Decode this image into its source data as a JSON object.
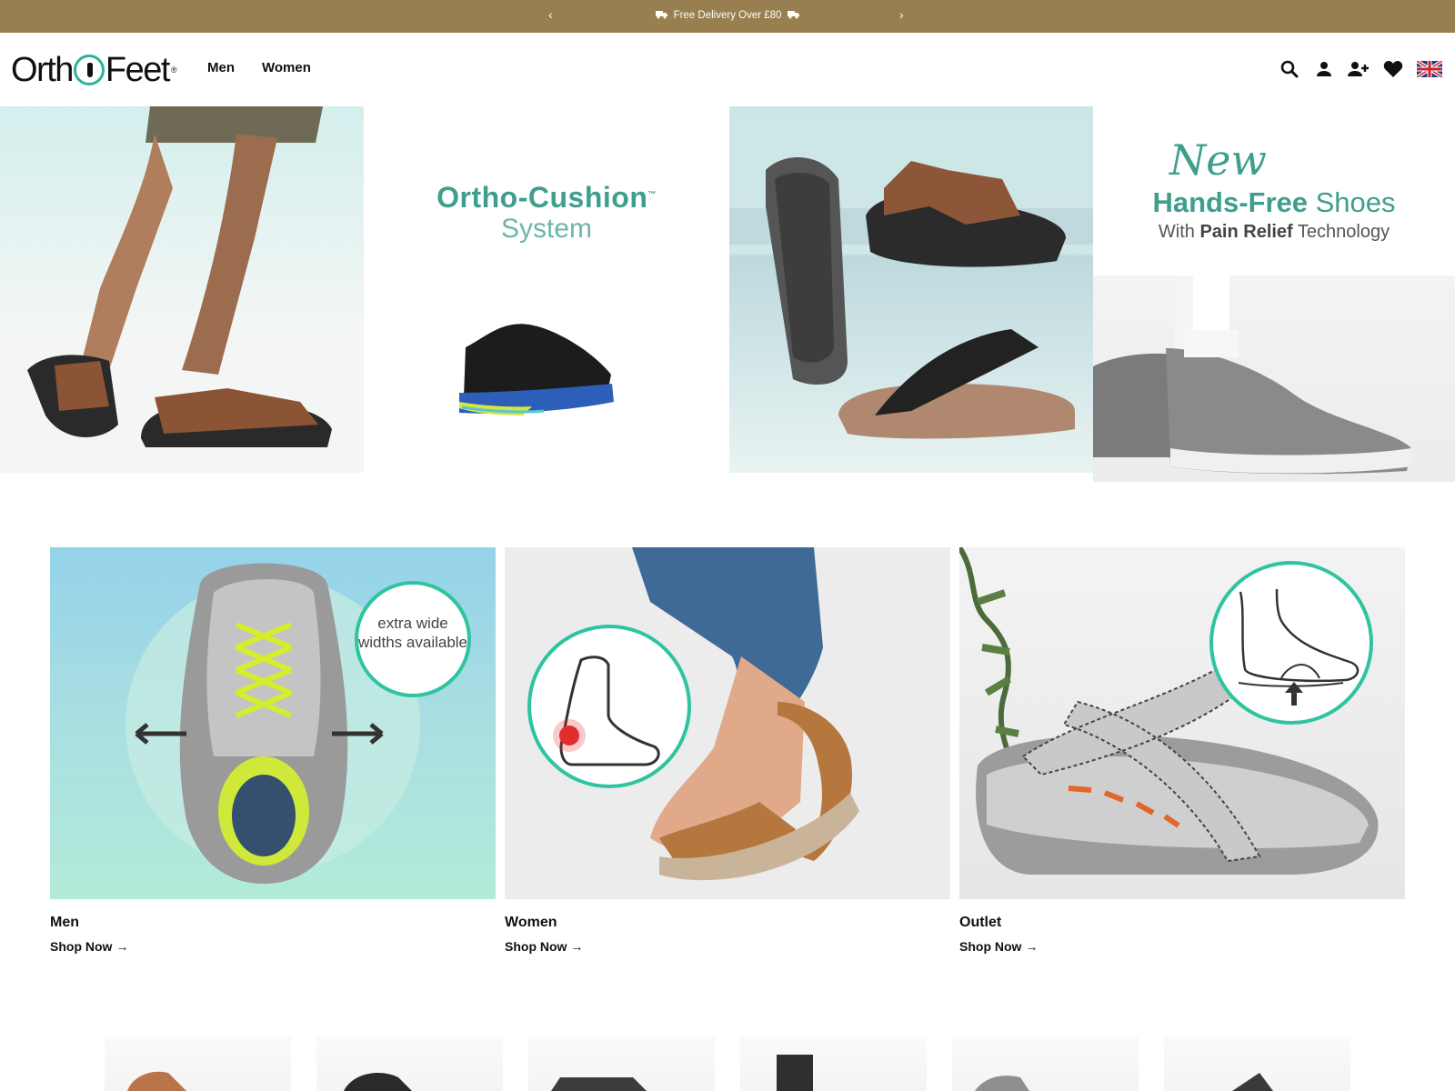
{
  "announcement": {
    "prev_label": "‹",
    "next_label": "›",
    "message": "Free Delivery Over £80"
  },
  "header": {
    "logo_text_left": "Orth",
    "logo_text_right": "Feet",
    "logo_mark": "®",
    "nav": [
      {
        "label": "Men"
      },
      {
        "label": "Women"
      }
    ],
    "icons": [
      "search-icon",
      "account-icon",
      "register-icon",
      "wishlist-icon",
      "uk-flag-icon"
    ]
  },
  "hero": {
    "panel2": {
      "title": "Ortho-Cushion",
      "trademark": "™",
      "subtitle": "System"
    },
    "panel4": {
      "script": "New",
      "title_bold": "Hands-Free",
      "title_light": "Shoes",
      "sub_prefix": "With",
      "sub_bold": "Pain Relief",
      "sub_suffix": "Technology"
    }
  },
  "categories": [
    {
      "name": "Men",
      "cta": "Shop Now →",
      "badge": "extra wide widths available"
    },
    {
      "name": "Women",
      "cta": "Shop Now →"
    },
    {
      "name": "Outlet",
      "cta": "Shop Now →"
    }
  ],
  "colors": {
    "announcement_bg": "#977f4f",
    "accent_teal": "#2ab49a",
    "text": "#111111"
  }
}
